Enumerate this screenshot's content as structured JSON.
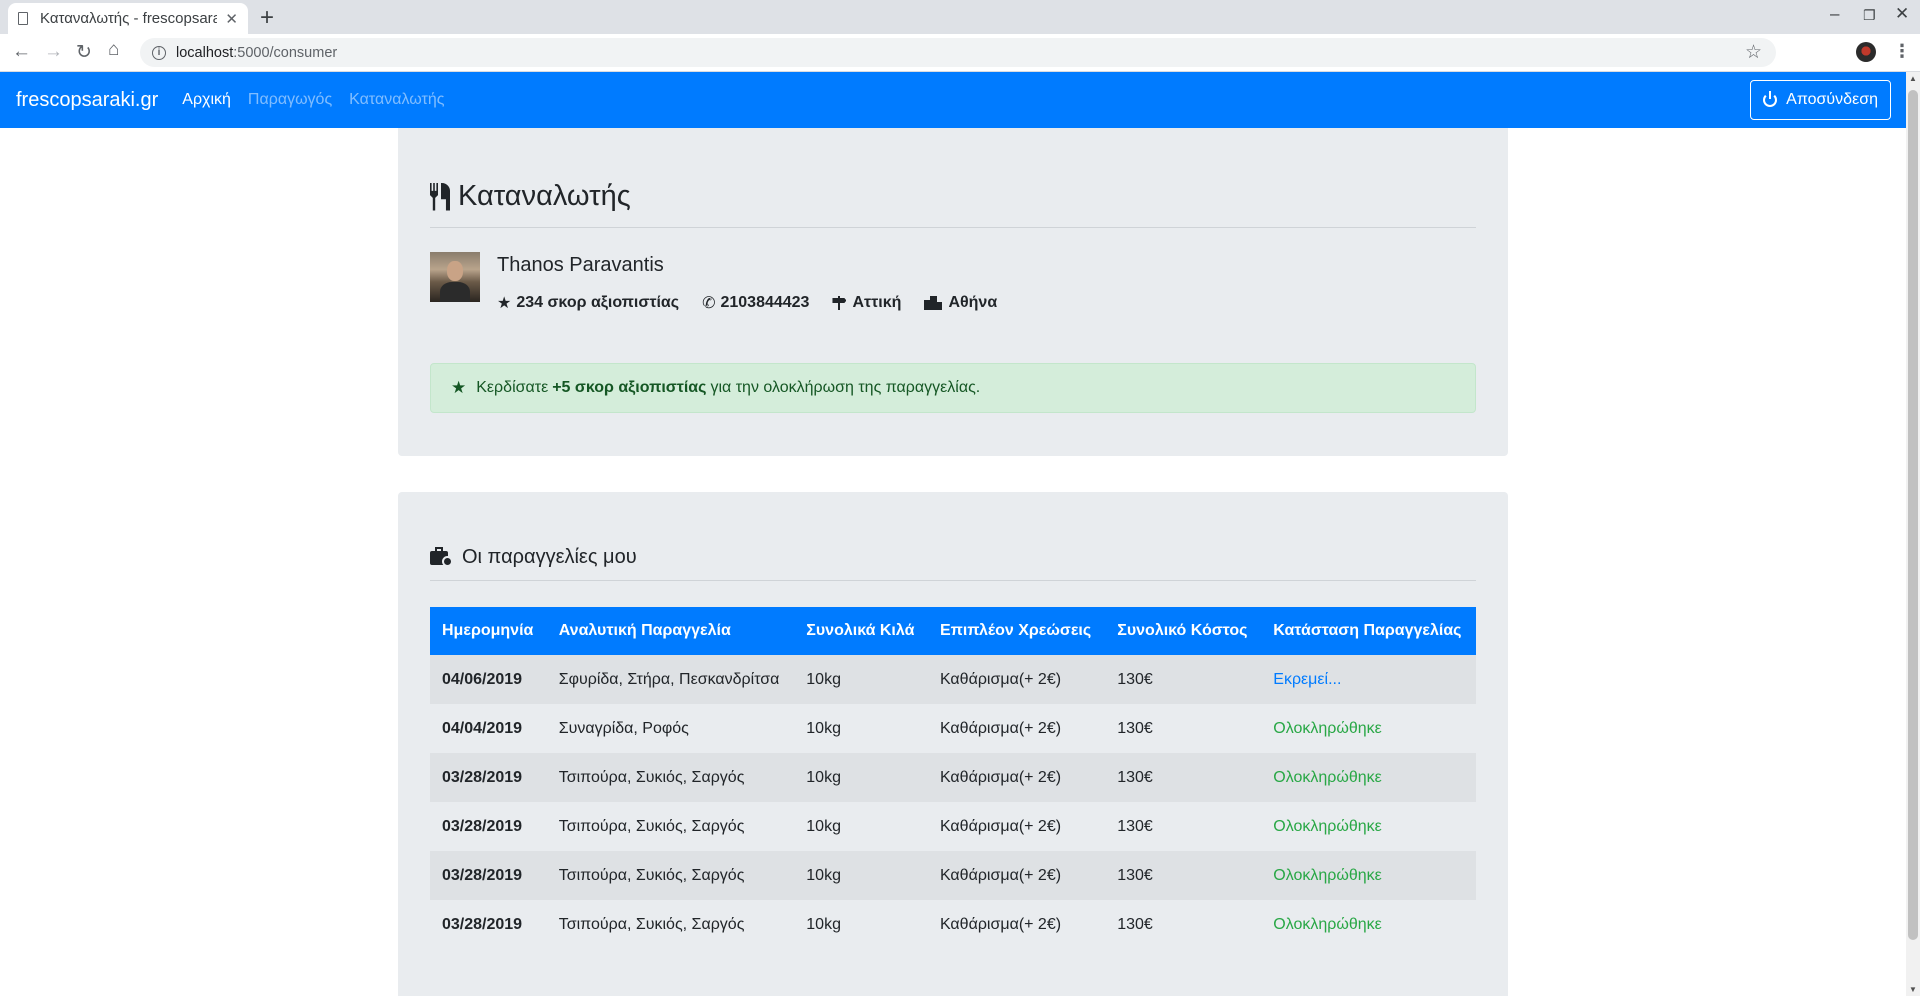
{
  "browser": {
    "tab_title": "Καταναλωτής - frescopsaraki.gr",
    "tab_close": "✕",
    "new_tab": "+",
    "url_host": "localhost",
    "url_path": ":5000/consumer"
  },
  "navbar": {
    "brand": "frescopsaraki.gr",
    "links": [
      "Αρχική",
      "Παραγωγός",
      "Καταναλωτής"
    ],
    "logout": "Αποσύνδεση"
  },
  "consumer": {
    "title": "Καταναλωτής",
    "name": "Thanos Paravantis",
    "score": "234 σκορ αξιοπιστίας",
    "phone": "2103844423",
    "region": "Αττική",
    "city": "Αθήνα"
  },
  "alert": {
    "prefix": "Κερδίσατε",
    "highlight": "+5 σκορ αξιοπιστίας",
    "suffix": "για την ολοκλήρωση της παραγγελίας."
  },
  "orders": {
    "title": "Οι παραγγελίες μου",
    "columns": [
      "Ημερομηνία",
      "Αναλυτική Παραγγελία",
      "Συνολικά Κιλά",
      "Επιπλέον Χρεώσεις",
      "Συνολικό Κόστος",
      "Κατάσταση Παραγγελίας"
    ],
    "rows": [
      [
        "04/06/2019",
        "Σφυρίδα, Στήρα, Πεσκανδρίτσα",
        "10kg",
        "Καθάρισμα(+ 2€)",
        "130€",
        "Εκρεμεί..."
      ],
      [
        "04/04/2019",
        "Συναγρίδα, Ροφός",
        "10kg",
        "Καθάρισμα(+ 2€)",
        "130€",
        "Ολοκληρώθηκε"
      ],
      [
        "03/28/2019",
        "Τσιπούρα, Συκιός, Σαργός",
        "10kg",
        "Καθάρισμα(+ 2€)",
        "130€",
        "Ολοκληρώθηκε"
      ],
      [
        "03/28/2019",
        "Τσιπούρα, Συκιός, Σαργός",
        "10kg",
        "Καθάρισμα(+ 2€)",
        "130€",
        "Ολοκληρώθηκε"
      ],
      [
        "03/28/2019",
        "Τσιπούρα, Συκιός, Σαργός",
        "10kg",
        "Καθάρισμα(+ 2€)",
        "130€",
        "Ολοκληρώθηκε"
      ],
      [
        "03/28/2019",
        "Τσιπούρα, Συκιός, Σαργός",
        "10kg",
        "Καθάρισμα(+ 2€)",
        "130€",
        "Ολοκληρώθηκε"
      ]
    ]
  },
  "colors": {
    "primary": "#007bff",
    "success": "#28a745",
    "card": "#e9ecef",
    "alert_bg": "#d4edda"
  }
}
